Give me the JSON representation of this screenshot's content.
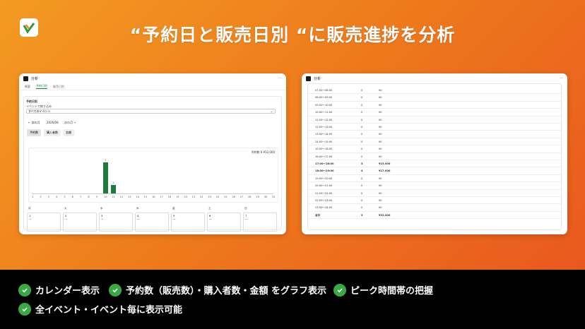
{
  "headline": "“予約日と販売日別 “に販売進捗を分析",
  "brand": {
    "accent": "#1f7a3d"
  },
  "left": {
    "app_title": "分析",
    "tabs": [
      "概要",
      "予約日別",
      "販売日別"
    ],
    "section_title": "予約日別",
    "filter_label": "イベントで絞り込み",
    "select_value": "すべてのイベント",
    "nav": {
      "prev": "← 前の月",
      "month": "2026/08",
      "next": "次の月 →"
    },
    "view_tabs": [
      "予約数",
      "購入者数",
      "金額"
    ],
    "summary": "予約数 9  ¥32,000",
    "chart_data": {
      "type": "bar",
      "categories": [
        "1",
        "2",
        "3",
        "4",
        "5",
        "6",
        "7",
        "8",
        "9",
        "10",
        "11",
        "12",
        "13",
        "14",
        "15",
        "16",
        "17",
        "18",
        "19",
        "20",
        "21",
        "22",
        "23",
        "24",
        "25",
        "26",
        "27",
        "28",
        "29",
        "30",
        "31"
      ],
      "values": [
        0,
        0,
        0,
        0,
        0,
        0,
        0,
        0,
        0,
        7,
        2,
        0,
        0,
        0,
        0,
        0,
        0,
        0,
        0,
        0,
        0,
        0,
        0,
        0,
        0,
        0,
        0,
        0,
        0,
        0,
        0
      ],
      "data_labels": [
        "",
        "",
        "",
        "",
        "",
        "",
        "",
        "",
        "",
        "7",
        "2",
        "",
        "",
        "",
        "",
        "",
        "",
        "",
        "",
        "",
        "",
        "",
        "",
        "",
        "",
        "",
        "",
        "",
        "",
        "",
        ""
      ],
      "ylim": [
        0,
        8
      ]
    },
    "weekdays": [
      "月",
      "火",
      "水",
      "木",
      "金",
      "土",
      "日"
    ],
    "calendar": [
      {
        "day": "1",
        "val": "—"
      },
      {
        "day": "2",
        "val": "—"
      },
      {
        "day": "3",
        "val": "—"
      },
      {
        "day": "4",
        "val": "—"
      },
      {
        "day": "5",
        "val": "—"
      },
      {
        "day": "6",
        "val": "—"
      },
      {
        "day": "7",
        "val": "—"
      }
    ]
  },
  "right": {
    "app_title": "分析",
    "rows": [
      {
        "t": "07:00〜08:00",
        "n": "0",
        "a": "¥0"
      },
      {
        "t": "08:00〜09:00",
        "n": "0",
        "a": "¥0"
      },
      {
        "t": "09:00〜10:00",
        "n": "0",
        "a": "¥0"
      },
      {
        "t": "10:00〜11:00",
        "n": "0",
        "a": "¥0"
      },
      {
        "t": "11:00〜12:00",
        "n": "0",
        "a": "¥0"
      },
      {
        "t": "12:00〜13:00",
        "n": "0",
        "a": "¥0"
      },
      {
        "t": "13:00〜14:00",
        "n": "0",
        "a": "¥0"
      },
      {
        "t": "14:00〜15:00",
        "n": "0",
        "a": "¥0"
      },
      {
        "t": "15:00〜16:00",
        "n": "0",
        "a": "¥0"
      },
      {
        "t": "16:00〜17:00",
        "n": "0",
        "a": "¥0"
      },
      {
        "t": "17:00〜18:00",
        "n": "5",
        "a": "¥15,000"
      },
      {
        "t": "18:00〜19:00",
        "n": "4",
        "a": "¥17,000"
      },
      {
        "t": "19:00〜20:00",
        "n": "0",
        "a": "¥0"
      },
      {
        "t": "20:00〜21:00",
        "n": "0",
        "a": "¥0"
      },
      {
        "t": "21:00〜22:00",
        "n": "0",
        "a": "¥0"
      },
      {
        "t": "22:00〜23:00",
        "n": "0",
        "a": "¥0"
      },
      {
        "t": "23:00〜24:00",
        "n": "0",
        "a": "¥0"
      },
      {
        "t": "合計",
        "n": "9",
        "a": "¥32,000"
      }
    ]
  },
  "features": [
    "カレンダー表示",
    "予約数（販売数）・購入者数・金額 をグラフ表示",
    "ピーク時間帯の把握",
    "全イベント・イベント毎に表示可能"
  ]
}
